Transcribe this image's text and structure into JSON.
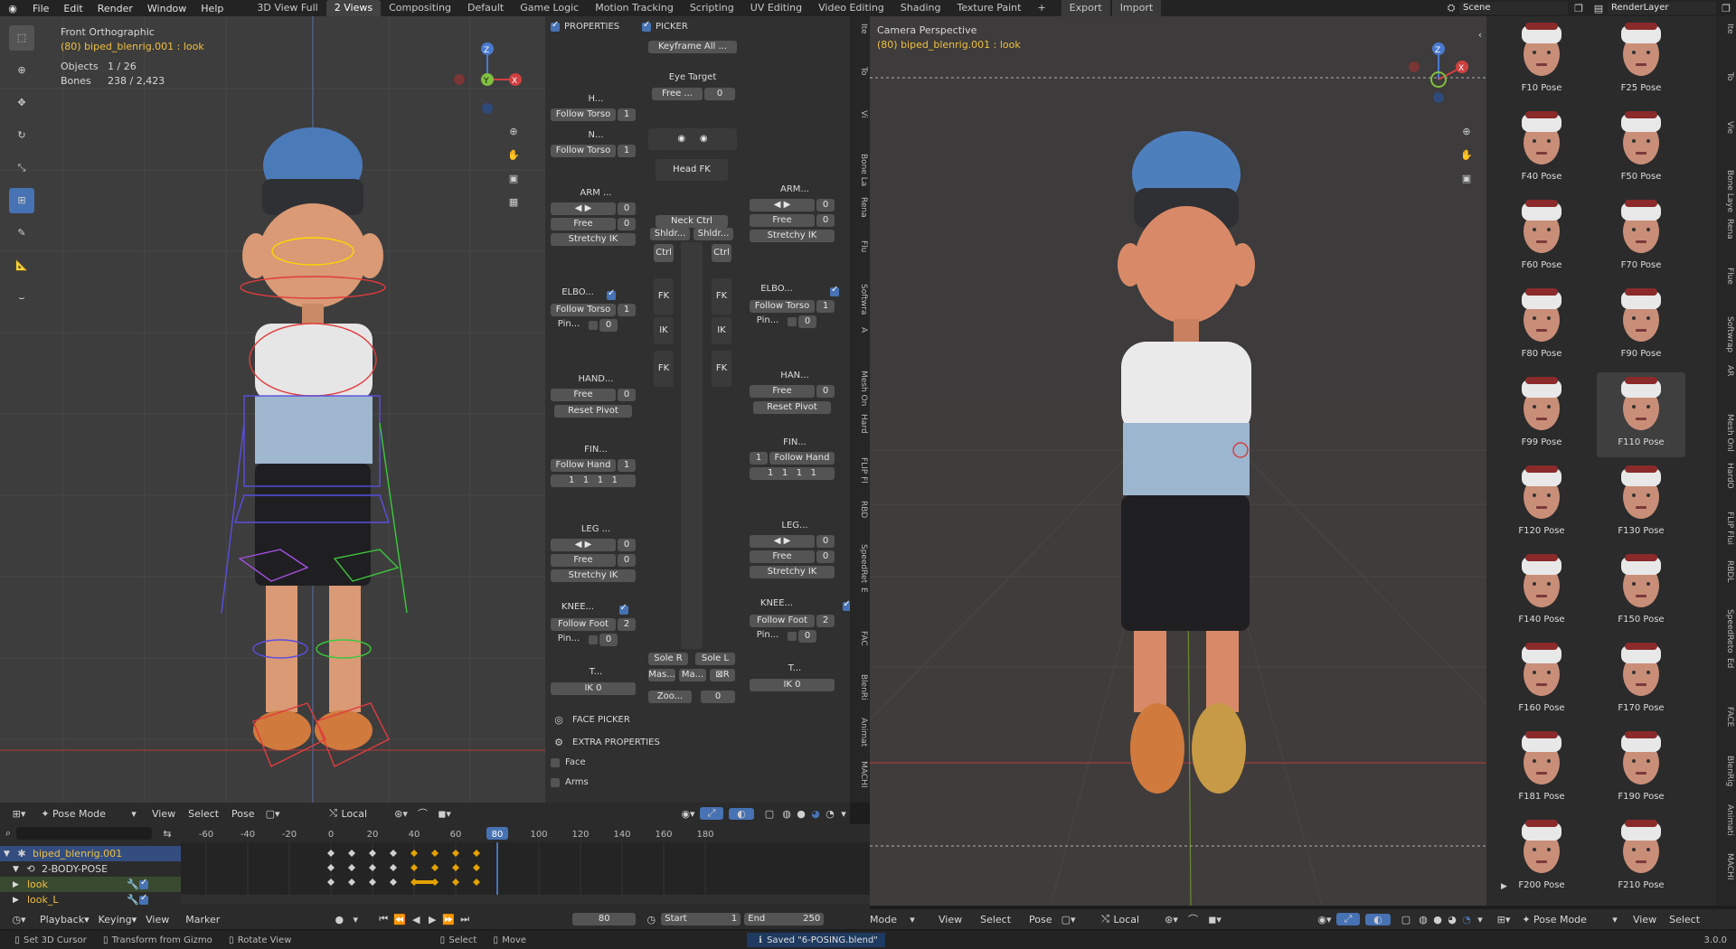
{
  "menu": [
    "File",
    "Edit",
    "Render",
    "Window",
    "Help"
  ],
  "workspaces": [
    "3D View Full",
    "2 Views",
    "Compositing",
    "Default",
    "Game Logic",
    "Motion Tracking",
    "Scripting",
    "UV Editing",
    "Video Editing",
    "Shading",
    "Texture Paint"
  ],
  "active_workspace": "2 Views",
  "topbar_right": {
    "export": "Export",
    "import": "Import",
    "scene": "Scene",
    "render_layer": "RenderLayer"
  },
  "left_view": {
    "title": "Front Orthographic",
    "subtitle": "(80) biped_blenrig.001 : look",
    "objects_label": "Objects",
    "objects_val": "1 / 26",
    "bones_label": "Bones",
    "bones_val": "238 / 2,423"
  },
  "right_view": {
    "title": "Camera Perspective",
    "subtitle": "(80) biped_blenrig.001 : look"
  },
  "picker": {
    "properties": "PROPERTIES",
    "picker": "PICKER",
    "keyframe_all": "Keyframe All ...",
    "eye_target": "Eye Target",
    "free": "Free ...",
    "zero": "0",
    "head_label": "H...",
    "follow_torso": "Follow Torso",
    "one": "1",
    "neck_label": "N...",
    "head_fk": "Head FK",
    "neck_ctrl": "Neck Ctrl",
    "arm_l": "ARM ...",
    "arm_r": "ARM...",
    "free2": "Free",
    "stretchy_ik": "Stretchy IK",
    "elbow_l": "ELBO...",
    "elbow_r": "ELBO...",
    "pin": "Pin...",
    "hand_l": "HAND...",
    "hand_r": "HAN...",
    "reset_pivot": "Reset Pivot",
    "fin_l": "FIN...",
    "fin_r": "FIN...",
    "follow_hand": "Follow Hand",
    "leg_l": "LEG ...",
    "leg_r": "LEG...",
    "knee_l": "KNEE...",
    "knee_r": "KNEE...",
    "follow_foot": "Follow Foot",
    "two": "2",
    "t_l": "T...",
    "t_r": "T...",
    "ik": "IK",
    "sole_r": "Sole R",
    "sole_l": "Sole L",
    "mas": "Mas...",
    "ma": "Ma...",
    "zoo": "Zoo...",
    "face_picker": "FACE PICKER",
    "extra_properties": "EXTRA PROPERTIES",
    "face": "Face",
    "arms": "Arms",
    "shldr": "Shldr...",
    "ctrl": "Ctrl",
    "fk": "FK",
    "ik2": "IK"
  },
  "side_tabs_mid": [
    "Ite",
    "To",
    "Vi",
    "Bone La",
    "Rena",
    "Flu",
    "Softwra",
    "A",
    "Mesh On",
    "Hard",
    "FLIP Fl",
    "RBD",
    "SpeedRet",
    "E",
    "FAC",
    "BlenRi",
    "Animat",
    "MACHI"
  ],
  "side_tabs_right": [
    "Ite",
    "To",
    "Vie",
    "Bone Laye",
    "Rena",
    "Flue",
    "Softwrap",
    "AR",
    "Mesh Onl",
    "HardO",
    "FLIP Flui",
    "RBDL",
    "SpeedReto",
    "Ed",
    "FACE",
    "BlenRig",
    "Animati",
    "MACHI"
  ],
  "poses": [
    "F10 Pose",
    "F25 Pose",
    "F40 Pose",
    "F50 Pose",
    "F60 Pose",
    "F70 Pose",
    "F80 Pose",
    "F90 Pose",
    "F99 Pose",
    "F110 Pose",
    "F120 Pose",
    "F130 Pose",
    "F140 Pose",
    "F150 Pose",
    "F160 Pose",
    "F170 Pose",
    "F181 Pose",
    "F190 Pose",
    "F200 Pose",
    "F210 Pose"
  ],
  "selected_pose": "F110 Pose",
  "viewport_header": {
    "mode": "Pose Mode",
    "view": "View",
    "select": "Select",
    "pose": "Pose",
    "orientation": "Local",
    "mode_right": "Mode"
  },
  "timeline": {
    "ticks": [
      "-60",
      "-40",
      "-20",
      "0",
      "20",
      "40",
      "60",
      "80",
      "100",
      "120",
      "140",
      "160",
      "180"
    ],
    "current_frame": "80",
    "outliner": [
      "biped_blenrig.001",
      "2-BODY-POSE",
      "look",
      "look_L"
    ],
    "playback": "Playback",
    "keying": "Keying",
    "view": "View",
    "marker": "Marker",
    "frame": "80",
    "start_label": "Start",
    "start": "1",
    "end_label": "End",
    "end": "250"
  },
  "status": {
    "set_cursor": "Set 3D Cursor",
    "transform": "Transform from Gizmo",
    "rotate": "Rotate View",
    "select": "Select",
    "move": "Move",
    "saved": "Saved \"6-POSING.blend\"",
    "version": "3.0.0"
  },
  "colors": {
    "bg": "#1d1d1d",
    "viewport": "#3d3d3d",
    "accent": "#4772b3",
    "active_frame": "#4772b3",
    "keyframe": "#e3a200",
    "grid_red": "#a03c3c"
  }
}
